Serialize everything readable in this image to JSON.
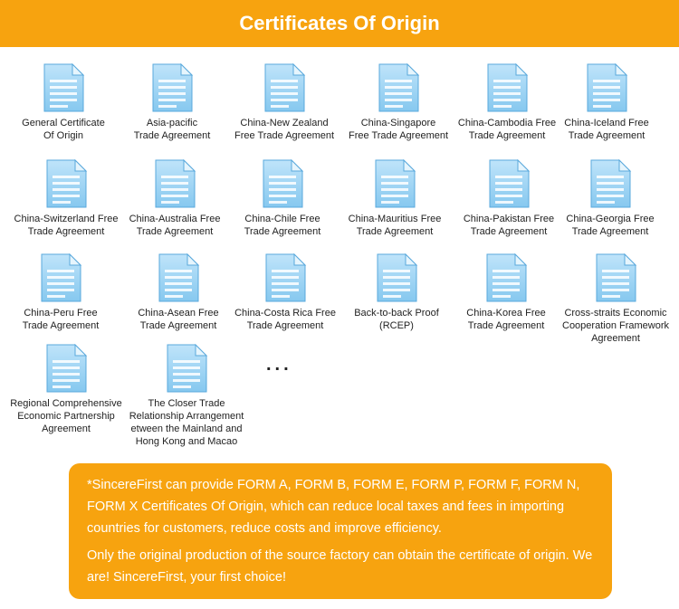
{
  "header": {
    "title": "Certificates Of Origin"
  },
  "documents": [
    "General Certificate\nOf Origin",
    "Asia-pacific\nTrade Agreement",
    "China-New Zealand\nFree Trade Agreement",
    "China-Singapore\nFree Trade Agreement",
    "China-Cambodia Free\nTrade Agreement",
    "China-Iceland Free\nTrade Agreement",
    "China-Switzerland Free\nTrade Agreement",
    "China-Australia Free\nTrade Agreement",
    "China-Chile Free\nTrade Agreement",
    "China-Mauritius Free\nTrade Agreement",
    "China-Pakistan Free\nTrade Agreement",
    "China-Georgia Free\nTrade Agreement",
    "China-Peru Free\nTrade Agreement",
    "China-Asean Free\nTrade Agreement",
    "China-Costa Rica Free\nTrade Agreement",
    "Back-to-back Proof\n(RCEP)",
    "China-Korea Free\nTrade Agreement",
    "Cross-straits Economic\nCooperation Framework\nAgreement",
    "Regional Comprehensive\nEconomic Partnership\nAgreement",
    "The Closer Trade\nRelationship Arrangement\netween the Mainland and\nHong Kong and Macao"
  ],
  "ellipsis": "...",
  "note": {
    "paragraph1": "*SincereFirst can provide FORM A, FORM B, FORM E, FORM P, FORM F, FORM N, FORM X Certificates Of Origin, which can reduce local taxes and fees in importing countries for customers, reduce costs and improve efficiency.",
    "paragraph2": "Only the original production of the source factory can obtain the certificate of origin. We are! SincereFirst, your first choice!"
  },
  "colors": {
    "accent": "#f7a30f",
    "icon_blue": "#8ecdf2"
  }
}
